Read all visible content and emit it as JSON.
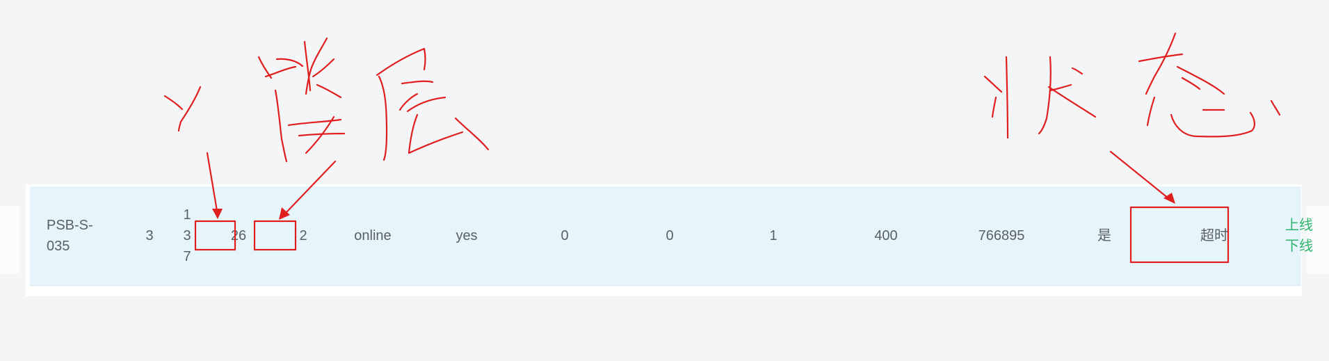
{
  "row": {
    "device": "PSB-S-035",
    "seq": "3",
    "id_number": "137",
    "units": "26",
    "floors": "2",
    "network": "online",
    "enabled": "yes",
    "v1": "0",
    "v2": "0",
    "v3": "1",
    "v4": "400",
    "v5": "766895",
    "yes_no": "是",
    "status": "超时",
    "actions": {
      "online": "上线",
      "offline": "下线"
    }
  },
  "colors": {
    "page_background": "#f4f5f7",
    "row_highlight": "#e6f5fc",
    "action_link": "#2db46a",
    "annotation": "#e01e1e"
  }
}
